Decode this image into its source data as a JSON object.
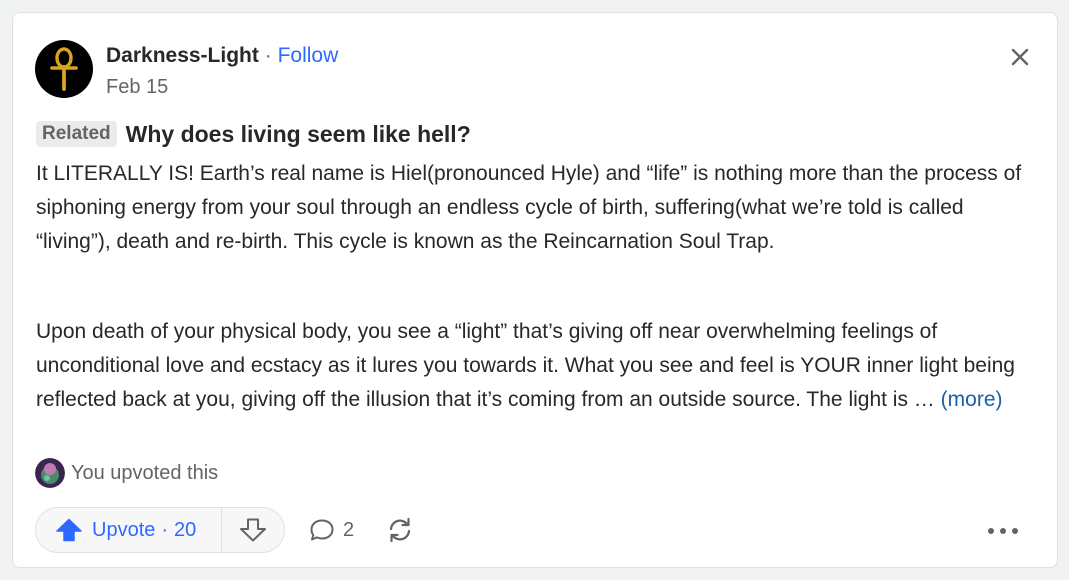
{
  "author": {
    "name": "Darkness-Light",
    "separator": "·",
    "follow_label": "Follow",
    "date": "Feb 15",
    "avatar_icon": "ankh-icon"
  },
  "post": {
    "badge": "Related",
    "question": "Why does living seem like hell?",
    "paragraph_1": "It LITERALLY IS! Earth’s real name is Hiel(pronounced Hyle) and “life” is nothing more than the process of siphoning energy from your soul through an endless cycle of birth, suffering(what we’re told is called “living”), death and re-birth. This cycle is known as the Reincarnation Soul Trap.",
    "paragraph_2": "Upon death of your physical body, you see a “light” that’s giving off near overwhelming feelings of unconditional love and ecstacy as it lures you towards it. What you see and feel is YOUR inner light being reflected back at you, giving off the illusion that it’s coming from an outside source. The light is …",
    "more_label": "(more)"
  },
  "upvoted_note": "You upvoted this",
  "actions": {
    "upvote_label": "Upvote",
    "separator": "·",
    "upvote_count": "20",
    "comment_count": "2"
  },
  "colors": {
    "accent": "#2e69ff",
    "more_link": "#195faa",
    "text": "#282829",
    "muted": "#636466",
    "ankh": "#d9a521"
  }
}
